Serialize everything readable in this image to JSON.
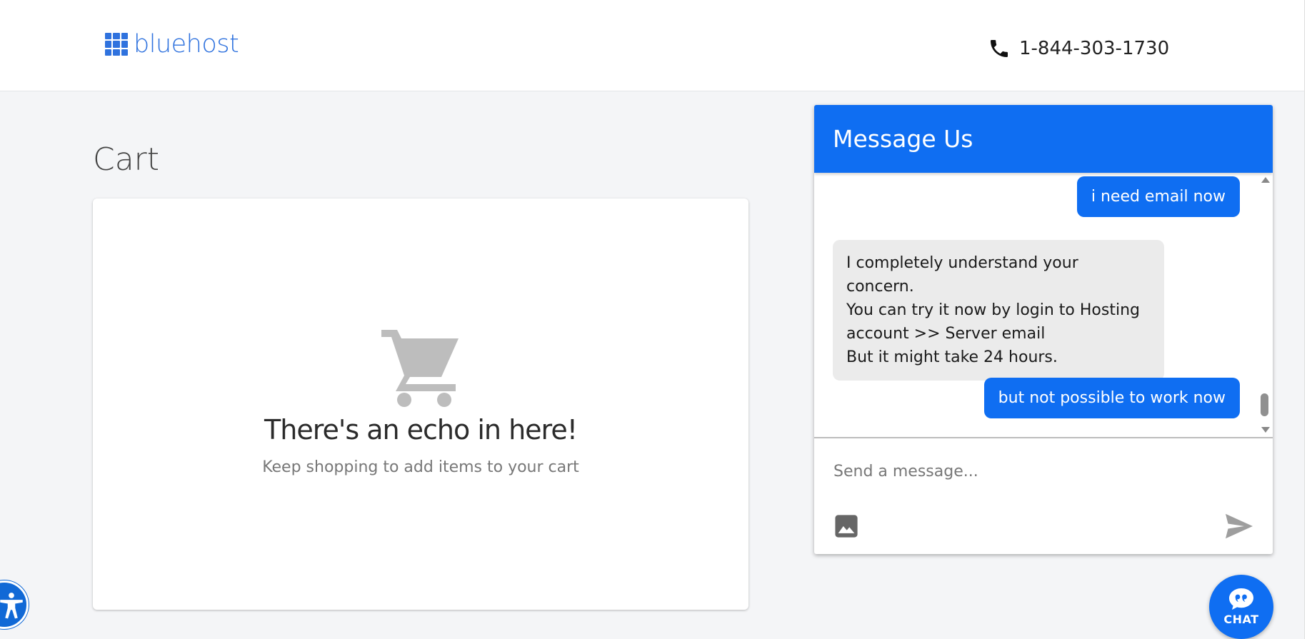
{
  "header": {
    "logo_text": "bluehost",
    "phone_number": "1-844-303-1730"
  },
  "cart": {
    "title": "Cart",
    "empty_title": "There's an echo in here!",
    "empty_subtitle": "Keep shopping to add items to your cart"
  },
  "chat": {
    "title": "Message Us",
    "messages": [
      {
        "sender": "user",
        "lines": [
          "i need email now"
        ]
      },
      {
        "sender": "agent",
        "lines": [
          "I completely understand your concern.",
          "You can  try it now by login to Hosting",
          "account >> Server email",
          "But it might take 24 hours."
        ]
      },
      {
        "sender": "user",
        "lines": [
          "but not possible to work now"
        ]
      }
    ],
    "input_placeholder": "Send a message...",
    "launcher_label": "CHAT"
  },
  "colors": {
    "brand_blue": "#0f6ef2",
    "logo_blue": "#2f72de",
    "page_bg": "#f4f5f7",
    "agent_bubble": "#ebebeb"
  },
  "icons": [
    "logo-grid-icon",
    "phone-icon",
    "cart-icon",
    "image-icon",
    "send-icon",
    "chat-quote-icon",
    "accessibility-icon"
  ]
}
